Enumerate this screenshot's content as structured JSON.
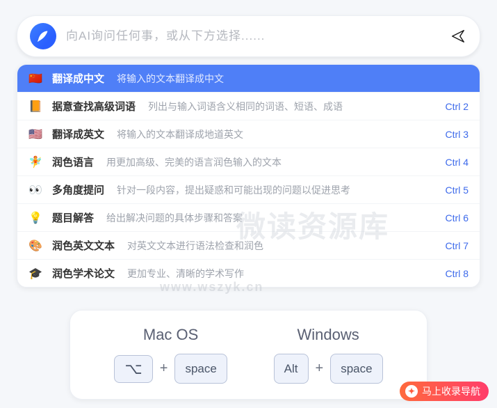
{
  "search": {
    "placeholder": "向AI询问任何事，或从下方选择......"
  },
  "menu": [
    {
      "icon": "🇨🇳",
      "title": "翻译成中文",
      "desc": "将输入的文本翻译成中文",
      "shortcut": "",
      "selected": true
    },
    {
      "icon": "📙",
      "title": "据意查找高级词语",
      "desc": "列出与输入词语含义相同的词语、短语、成语",
      "shortcut": "Ctrl 2",
      "selected": false
    },
    {
      "icon": "🇺🇸",
      "title": "翻译成英文",
      "desc": "将输入的文本翻译成地道英文",
      "shortcut": "Ctrl 3",
      "selected": false
    },
    {
      "icon": "🧚",
      "title": "润色语言",
      "desc": "用更加高级、完美的语言润色输入的文本",
      "shortcut": "Ctrl 4",
      "selected": false
    },
    {
      "icon": "👀",
      "title": "多角度提问",
      "desc": "针对一段内容，提出疑惑和可能出现的问题以促进思考",
      "shortcut": "Ctrl 5",
      "selected": false
    },
    {
      "icon": "💡",
      "title": "题目解答",
      "desc": "给出解决问题的具体步骤和答案",
      "shortcut": "Ctrl 6",
      "selected": false
    },
    {
      "icon": "🎨",
      "title": "润色英文文本",
      "desc": "对英文文本进行语法检查和润色",
      "shortcut": "Ctrl 7",
      "selected": false
    },
    {
      "icon": "🎓",
      "title": "润色学术论文",
      "desc": "更加专业、清晰的学术写作",
      "shortcut": "Ctrl 8",
      "selected": false
    }
  ],
  "shortcuts": {
    "mac": {
      "label": "Mac OS",
      "key1": "⌥",
      "key2": "space",
      "plus": "+"
    },
    "windows": {
      "label": "Windows",
      "key1": "Alt",
      "key2": "space",
      "plus": "+"
    }
  },
  "watermark": {
    "title": "微读资源库",
    "url": "www.wszyk.cn"
  },
  "footer": {
    "text": "马上收录导航"
  }
}
